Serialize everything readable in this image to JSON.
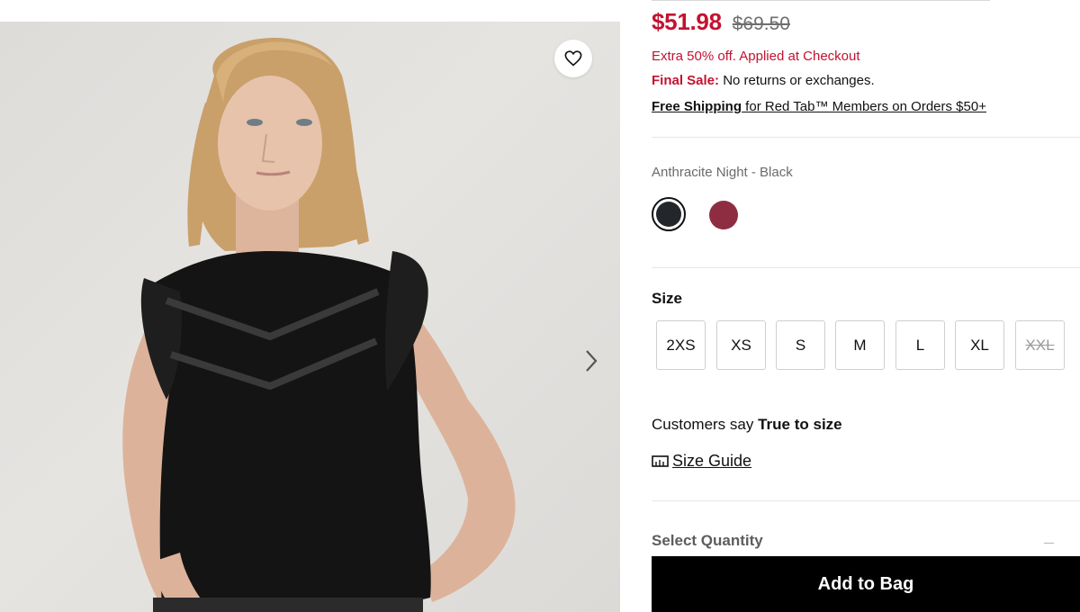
{
  "product": {
    "sale_price": "$51.98",
    "original_price": "$69.50",
    "promo": "Extra 50% off. Applied at Checkout",
    "final_sale_label": "Final Sale:",
    "final_sale_text": " No returns or exchanges.",
    "shipping_link": "Free Shipping",
    "shipping_text": " for Red Tab™ Members on Orders $50+"
  },
  "color": {
    "selected_name": "Anthracite Night - Black",
    "swatches": [
      {
        "name": "Anthracite Night - Black",
        "hex": "#23262b",
        "selected": true
      },
      {
        "name": "red",
        "hex": "#8e2d42",
        "selected": false
      }
    ]
  },
  "size": {
    "title": "Size",
    "options": [
      {
        "label": "2XS",
        "available": true
      },
      {
        "label": "XS",
        "available": true
      },
      {
        "label": "S",
        "available": true
      },
      {
        "label": "M",
        "available": true
      },
      {
        "label": "L",
        "available": true
      },
      {
        "label": "XL",
        "available": true
      },
      {
        "label": "XXL",
        "available": false
      }
    ],
    "fit_prefix": "Customers say ",
    "fit_value": "True to size",
    "guide_label": "Size Guide"
  },
  "quantity": {
    "label": "Select Quantity"
  },
  "actions": {
    "add_to_bag": "Add to Bag"
  },
  "icons": {
    "wishlist": "heart-icon",
    "next_image": "chevron-right-icon",
    "size_guide": "ruler-icon"
  },
  "colors": {
    "sale_red": "#c41230",
    "button_black": "#000000"
  }
}
